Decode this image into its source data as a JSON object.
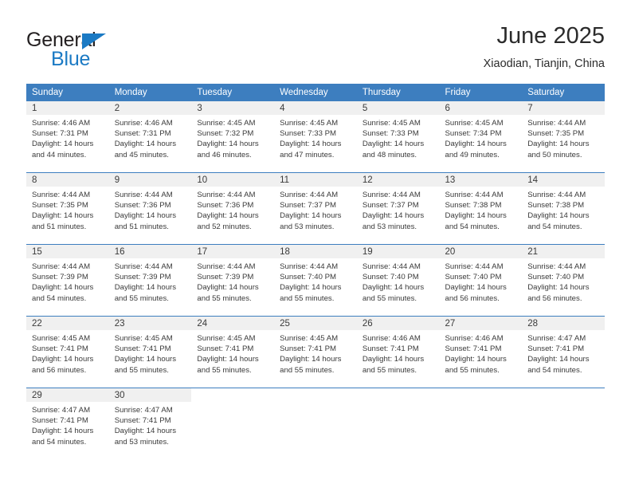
{
  "brand": {
    "name_top": "General",
    "name_bottom": "Blue",
    "triangle_icon": "triangle-icon",
    "color_dark": "#231f20",
    "color_blue": "#1b7ac4"
  },
  "header": {
    "title": "June 2025",
    "subtitle": "Xiaodian, Tianjin, China"
  },
  "theme": {
    "header_bg": "#3d7ebf",
    "daynum_bg": "#f0f0f0",
    "text": "#3a3a3a"
  },
  "calendar": {
    "weekdays": [
      "Sunday",
      "Monday",
      "Tuesday",
      "Wednesday",
      "Thursday",
      "Friday",
      "Saturday"
    ],
    "weeks": [
      [
        {
          "day": "1",
          "sunrise": "Sunrise: 4:46 AM",
          "sunset": "Sunset: 7:31 PM",
          "daylight1": "Daylight: 14 hours",
          "daylight2": "and 44 minutes."
        },
        {
          "day": "2",
          "sunrise": "Sunrise: 4:46 AM",
          "sunset": "Sunset: 7:31 PM",
          "daylight1": "Daylight: 14 hours",
          "daylight2": "and 45 minutes."
        },
        {
          "day": "3",
          "sunrise": "Sunrise: 4:45 AM",
          "sunset": "Sunset: 7:32 PM",
          "daylight1": "Daylight: 14 hours",
          "daylight2": "and 46 minutes."
        },
        {
          "day": "4",
          "sunrise": "Sunrise: 4:45 AM",
          "sunset": "Sunset: 7:33 PM",
          "daylight1": "Daylight: 14 hours",
          "daylight2": "and 47 minutes."
        },
        {
          "day": "5",
          "sunrise": "Sunrise: 4:45 AM",
          "sunset": "Sunset: 7:33 PM",
          "daylight1": "Daylight: 14 hours",
          "daylight2": "and 48 minutes."
        },
        {
          "day": "6",
          "sunrise": "Sunrise: 4:45 AM",
          "sunset": "Sunset: 7:34 PM",
          "daylight1": "Daylight: 14 hours",
          "daylight2": "and 49 minutes."
        },
        {
          "day": "7",
          "sunrise": "Sunrise: 4:44 AM",
          "sunset": "Sunset: 7:35 PM",
          "daylight1": "Daylight: 14 hours",
          "daylight2": "and 50 minutes."
        }
      ],
      [
        {
          "day": "8",
          "sunrise": "Sunrise: 4:44 AM",
          "sunset": "Sunset: 7:35 PM",
          "daylight1": "Daylight: 14 hours",
          "daylight2": "and 51 minutes."
        },
        {
          "day": "9",
          "sunrise": "Sunrise: 4:44 AM",
          "sunset": "Sunset: 7:36 PM",
          "daylight1": "Daylight: 14 hours",
          "daylight2": "and 51 minutes."
        },
        {
          "day": "10",
          "sunrise": "Sunrise: 4:44 AM",
          "sunset": "Sunset: 7:36 PM",
          "daylight1": "Daylight: 14 hours",
          "daylight2": "and 52 minutes."
        },
        {
          "day": "11",
          "sunrise": "Sunrise: 4:44 AM",
          "sunset": "Sunset: 7:37 PM",
          "daylight1": "Daylight: 14 hours",
          "daylight2": "and 53 minutes."
        },
        {
          "day": "12",
          "sunrise": "Sunrise: 4:44 AM",
          "sunset": "Sunset: 7:37 PM",
          "daylight1": "Daylight: 14 hours",
          "daylight2": "and 53 minutes."
        },
        {
          "day": "13",
          "sunrise": "Sunrise: 4:44 AM",
          "sunset": "Sunset: 7:38 PM",
          "daylight1": "Daylight: 14 hours",
          "daylight2": "and 54 minutes."
        },
        {
          "day": "14",
          "sunrise": "Sunrise: 4:44 AM",
          "sunset": "Sunset: 7:38 PM",
          "daylight1": "Daylight: 14 hours",
          "daylight2": "and 54 minutes."
        }
      ],
      [
        {
          "day": "15",
          "sunrise": "Sunrise: 4:44 AM",
          "sunset": "Sunset: 7:39 PM",
          "daylight1": "Daylight: 14 hours",
          "daylight2": "and 54 minutes."
        },
        {
          "day": "16",
          "sunrise": "Sunrise: 4:44 AM",
          "sunset": "Sunset: 7:39 PM",
          "daylight1": "Daylight: 14 hours",
          "daylight2": "and 55 minutes."
        },
        {
          "day": "17",
          "sunrise": "Sunrise: 4:44 AM",
          "sunset": "Sunset: 7:39 PM",
          "daylight1": "Daylight: 14 hours",
          "daylight2": "and 55 minutes."
        },
        {
          "day": "18",
          "sunrise": "Sunrise: 4:44 AM",
          "sunset": "Sunset: 7:40 PM",
          "daylight1": "Daylight: 14 hours",
          "daylight2": "and 55 minutes."
        },
        {
          "day": "19",
          "sunrise": "Sunrise: 4:44 AM",
          "sunset": "Sunset: 7:40 PM",
          "daylight1": "Daylight: 14 hours",
          "daylight2": "and 55 minutes."
        },
        {
          "day": "20",
          "sunrise": "Sunrise: 4:44 AM",
          "sunset": "Sunset: 7:40 PM",
          "daylight1": "Daylight: 14 hours",
          "daylight2": "and 56 minutes."
        },
        {
          "day": "21",
          "sunrise": "Sunrise: 4:44 AM",
          "sunset": "Sunset: 7:40 PM",
          "daylight1": "Daylight: 14 hours",
          "daylight2": "and 56 minutes."
        }
      ],
      [
        {
          "day": "22",
          "sunrise": "Sunrise: 4:45 AM",
          "sunset": "Sunset: 7:41 PM",
          "daylight1": "Daylight: 14 hours",
          "daylight2": "and 56 minutes."
        },
        {
          "day": "23",
          "sunrise": "Sunrise: 4:45 AM",
          "sunset": "Sunset: 7:41 PM",
          "daylight1": "Daylight: 14 hours",
          "daylight2": "and 55 minutes."
        },
        {
          "day": "24",
          "sunrise": "Sunrise: 4:45 AM",
          "sunset": "Sunset: 7:41 PM",
          "daylight1": "Daylight: 14 hours",
          "daylight2": "and 55 minutes."
        },
        {
          "day": "25",
          "sunrise": "Sunrise: 4:45 AM",
          "sunset": "Sunset: 7:41 PM",
          "daylight1": "Daylight: 14 hours",
          "daylight2": "and 55 minutes."
        },
        {
          "day": "26",
          "sunrise": "Sunrise: 4:46 AM",
          "sunset": "Sunset: 7:41 PM",
          "daylight1": "Daylight: 14 hours",
          "daylight2": "and 55 minutes."
        },
        {
          "day": "27",
          "sunrise": "Sunrise: 4:46 AM",
          "sunset": "Sunset: 7:41 PM",
          "daylight1": "Daylight: 14 hours",
          "daylight2": "and 55 minutes."
        },
        {
          "day": "28",
          "sunrise": "Sunrise: 4:47 AM",
          "sunset": "Sunset: 7:41 PM",
          "daylight1": "Daylight: 14 hours",
          "daylight2": "and 54 minutes."
        }
      ],
      [
        {
          "day": "29",
          "sunrise": "Sunrise: 4:47 AM",
          "sunset": "Sunset: 7:41 PM",
          "daylight1": "Daylight: 14 hours",
          "daylight2": "and 54 minutes."
        },
        {
          "day": "30",
          "sunrise": "Sunrise: 4:47 AM",
          "sunset": "Sunset: 7:41 PM",
          "daylight1": "Daylight: 14 hours",
          "daylight2": "and 53 minutes."
        },
        {
          "day": "",
          "sunrise": "",
          "sunset": "",
          "daylight1": "",
          "daylight2": ""
        },
        {
          "day": "",
          "sunrise": "",
          "sunset": "",
          "daylight1": "",
          "daylight2": ""
        },
        {
          "day": "",
          "sunrise": "",
          "sunset": "",
          "daylight1": "",
          "daylight2": ""
        },
        {
          "day": "",
          "sunrise": "",
          "sunset": "",
          "daylight1": "",
          "daylight2": ""
        },
        {
          "day": "",
          "sunrise": "",
          "sunset": "",
          "daylight1": "",
          "daylight2": ""
        }
      ]
    ]
  }
}
